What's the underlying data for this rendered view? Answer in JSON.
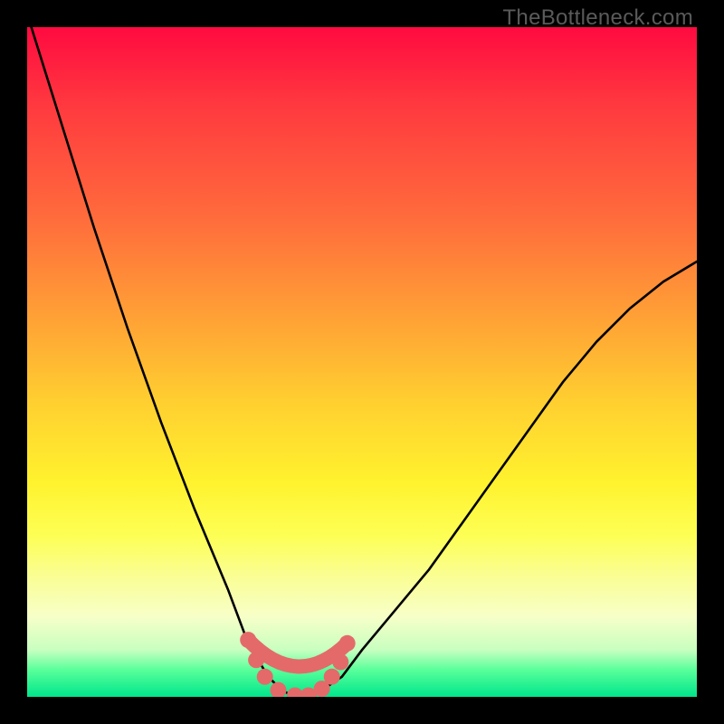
{
  "watermark": "TheBottleneck.com",
  "chart_data": {
    "type": "line",
    "title": "",
    "xlabel": "",
    "ylabel": "",
    "xlim": [
      0,
      1
    ],
    "ylim": [
      0,
      1
    ],
    "series": [
      {
        "name": "bottleneck-curve",
        "x": [
          0.0,
          0.05,
          0.1,
          0.15,
          0.2,
          0.25,
          0.3,
          0.33,
          0.36,
          0.38,
          0.4,
          0.42,
          0.44,
          0.47,
          0.5,
          0.55,
          0.6,
          0.65,
          0.7,
          0.75,
          0.8,
          0.85,
          0.9,
          0.95,
          1.0
        ],
        "y": [
          1.02,
          0.86,
          0.7,
          0.55,
          0.41,
          0.28,
          0.16,
          0.08,
          0.03,
          0.01,
          0.0,
          0.0,
          0.01,
          0.03,
          0.07,
          0.13,
          0.19,
          0.26,
          0.33,
          0.4,
          0.47,
          0.53,
          0.58,
          0.62,
          0.65
        ]
      }
    ],
    "markers": {
      "name": "highlight-dots",
      "color": "#e46a6a",
      "x": [
        0.33,
        0.342,
        0.355,
        0.375,
        0.4,
        0.42,
        0.44,
        0.455,
        0.468,
        0.478
      ],
      "y": [
        0.085,
        0.055,
        0.03,
        0.01,
        0.002,
        0.002,
        0.012,
        0.03,
        0.052,
        0.08
      ]
    },
    "gradient_stops": [
      {
        "pos": 0.0,
        "color": "#ff0a40"
      },
      {
        "pos": 0.12,
        "color": "#ff3a3f"
      },
      {
        "pos": 0.28,
        "color": "#ff6a3c"
      },
      {
        "pos": 0.42,
        "color": "#ff9c36"
      },
      {
        "pos": 0.56,
        "color": "#ffcf30"
      },
      {
        "pos": 0.68,
        "color": "#fff22e"
      },
      {
        "pos": 0.76,
        "color": "#fdff55"
      },
      {
        "pos": 0.82,
        "color": "#fafe93"
      },
      {
        "pos": 0.88,
        "color": "#f7ffc8"
      },
      {
        "pos": 0.93,
        "color": "#c8ffc0"
      },
      {
        "pos": 0.96,
        "color": "#58ff9a"
      },
      {
        "pos": 1.0,
        "color": "#00e68b"
      }
    ]
  }
}
